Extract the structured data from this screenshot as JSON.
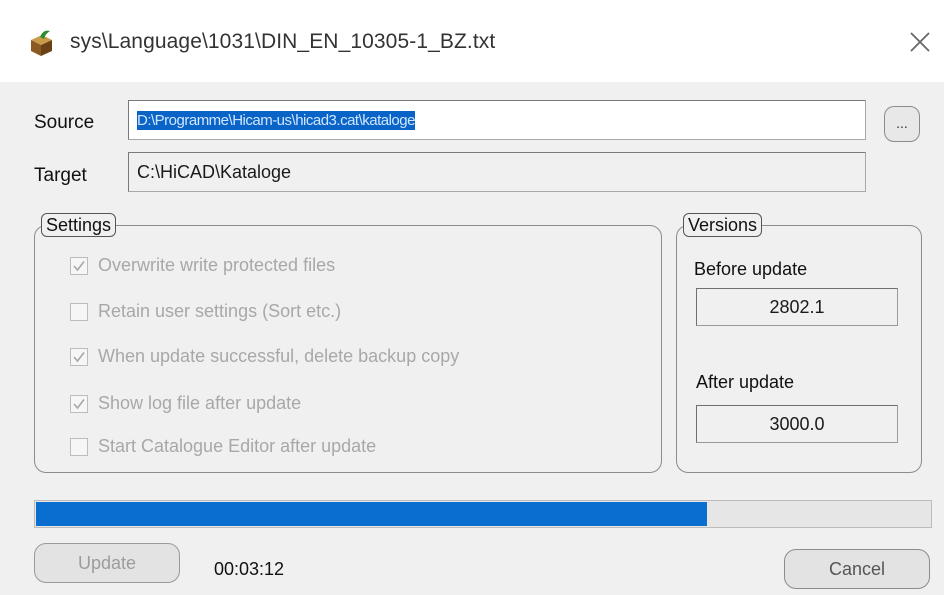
{
  "title": "sys\\Language\\1031\\DIN_EN_10305-1_BZ.txt",
  "icons": {
    "app": "package-icon",
    "close": "close-icon",
    "checkmark": "checkmark-icon"
  },
  "source": {
    "label": "Source",
    "value": "D:\\Programme\\Hicam-us\\hicad3.cat\\kataloge"
  },
  "target": {
    "label": "Target",
    "value": "C:\\HiCAD\\Kataloge"
  },
  "browse_label": "...",
  "settings": {
    "title": "Settings",
    "options": [
      {
        "label": "Overwrite write protected files",
        "checked": true
      },
      {
        "label": "Retain user settings (Sort etc.)",
        "checked": false
      },
      {
        "label": "When update successful, delete backup copy",
        "checked": true
      },
      {
        "label": "Show log file after update",
        "checked": true
      },
      {
        "label": "Start Catalogue Editor after update",
        "checked": false
      }
    ]
  },
  "versions": {
    "title": "Versions",
    "before_label": "Before update",
    "before_value": "2802.1",
    "after_label": "After update",
    "after_value": "3000.0"
  },
  "progress": {
    "fraction": 0.75,
    "color": "#0a6ed1"
  },
  "buttons": {
    "update": "Update",
    "cancel": "Cancel"
  },
  "elapsed": "00:03:12"
}
